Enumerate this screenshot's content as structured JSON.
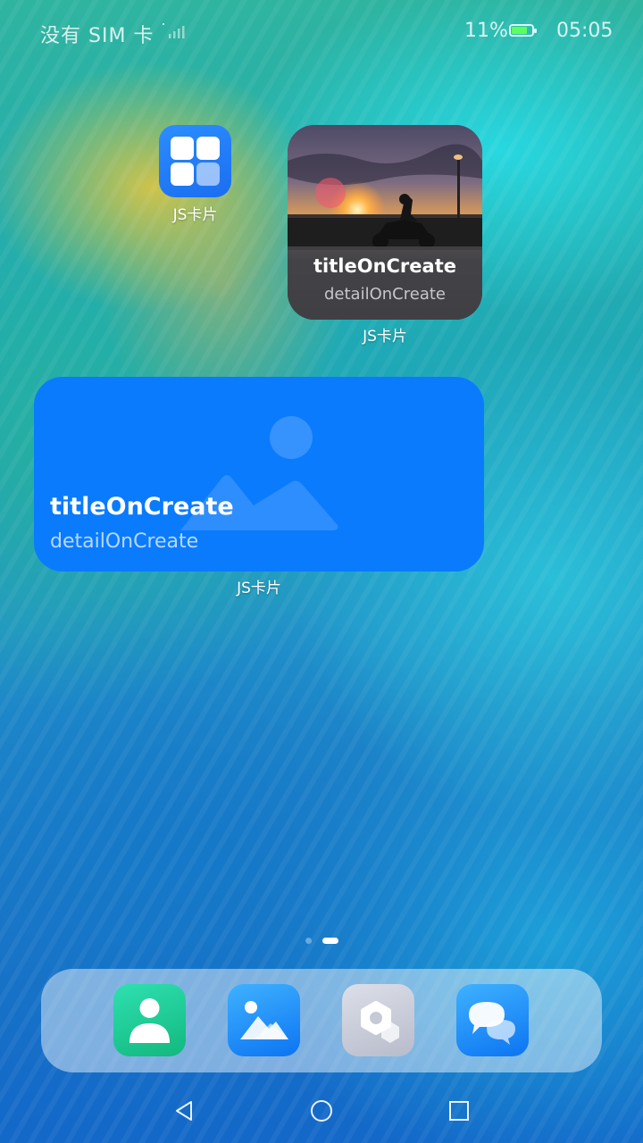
{
  "status_bar": {
    "carrier": "没有 SIM 卡",
    "battery_percent": "11%",
    "battery_level": 0.11,
    "time": "05:05"
  },
  "app_icon": {
    "label": "JS卡片",
    "icon": "grid-app-icon",
    "color": "#1a73f5"
  },
  "photo_card": {
    "title": "titleOnCreate",
    "detail": "detailOnCreate",
    "label": "JS卡片"
  },
  "blue_card": {
    "title": "titleOnCreate",
    "detail": "detailOnCreate",
    "label": "JS卡片",
    "color": "#0a7bfd"
  },
  "page_indicator": {
    "pages": 2,
    "active": 2
  },
  "dock": {
    "apps": [
      {
        "name": "contacts",
        "icon": "contacts-icon",
        "color": "#18c48c"
      },
      {
        "name": "gallery",
        "icon": "gallery-icon",
        "color": "#1e8cf7"
      },
      {
        "name": "settings",
        "icon": "settings-icon",
        "color": "#c9ccd8"
      },
      {
        "name": "messages",
        "icon": "messages-icon",
        "color": "#1e8cf7"
      }
    ]
  },
  "nav_bar": {
    "buttons": [
      "back",
      "home",
      "recents"
    ]
  }
}
